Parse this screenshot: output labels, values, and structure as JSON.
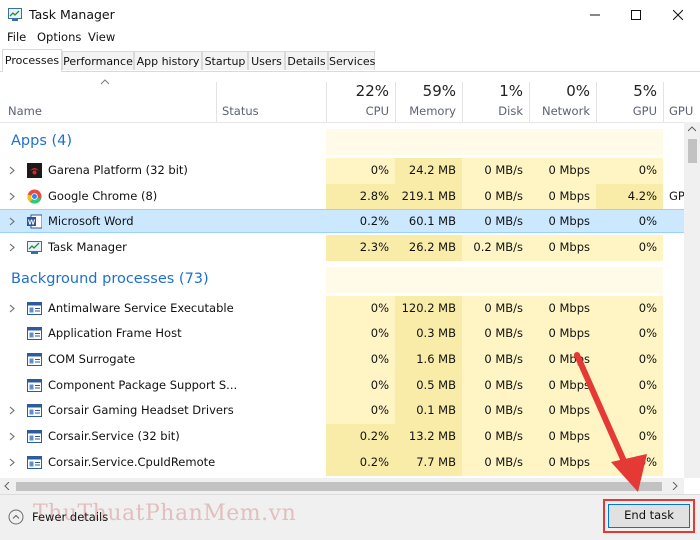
{
  "window": {
    "title": "Task Manager"
  },
  "menu": [
    "File",
    "Options",
    "View"
  ],
  "tabs": [
    "Processes",
    "Performance",
    "App history",
    "Startup",
    "Users",
    "Details",
    "Services"
  ],
  "active_tab": "Processes",
  "header": {
    "name": "Name",
    "status": "Status",
    "cpu": {
      "pct": "22%",
      "label": "CPU"
    },
    "memory": {
      "pct": "59%",
      "label": "Memory"
    },
    "disk": {
      "pct": "1%",
      "label": "Disk"
    },
    "network": {
      "pct": "0%",
      "label": "Network"
    },
    "gpu": {
      "pct": "5%",
      "label": "GPU"
    },
    "gpu_engine": {
      "label": "GPU e"
    }
  },
  "groups": {
    "apps": "Apps (4)",
    "background": "Background processes (73)"
  },
  "rows": [
    {
      "name": "Garena Platform (32 bit)",
      "icon": "garena-icon",
      "cpu": "0%",
      "memory": "24.2 MB",
      "disk": "0 MB/s",
      "network": "0 Mbps",
      "gpu": "0%",
      "gpu_engine": ""
    },
    {
      "name": "Google Chrome (8)",
      "icon": "chrome-icon",
      "cpu": "2.8%",
      "memory": "219.1 MB",
      "disk": "0 MB/s",
      "network": "0 Mbps",
      "gpu": "4.2%",
      "gpu_engine": "GP"
    },
    {
      "name": "Microsoft Word",
      "icon": "word-icon",
      "cpu": "0.2%",
      "memory": "60.1 MB",
      "disk": "0 MB/s",
      "network": "0 Mbps",
      "gpu": "0%",
      "gpu_engine": ""
    },
    {
      "name": "Task Manager",
      "icon": "task-manager-icon",
      "cpu": "2.3%",
      "memory": "26.2 MB",
      "disk": "0.2 MB/s",
      "network": "0 Mbps",
      "gpu": "0%",
      "gpu_engine": ""
    },
    {
      "name": "Antimalware Service Executable",
      "icon": "service-icon",
      "cpu": "0%",
      "memory": "120.2 MB",
      "disk": "0 MB/s",
      "network": "0 Mbps",
      "gpu": "0%",
      "gpu_engine": ""
    },
    {
      "name": "Application Frame Host",
      "icon": "service-icon",
      "cpu": "0%",
      "memory": "0.3 MB",
      "disk": "0 MB/s",
      "network": "0 Mbps",
      "gpu": "0%",
      "gpu_engine": ""
    },
    {
      "name": "COM Surrogate",
      "icon": "service-icon",
      "cpu": "0%",
      "memory": "1.6 MB",
      "disk": "0 MB/s",
      "network": "0 Mbps",
      "gpu": "0%",
      "gpu_engine": ""
    },
    {
      "name": "Component Package Support S...",
      "icon": "service-icon",
      "cpu": "0%",
      "memory": "0.5 MB",
      "disk": "0 MB/s",
      "network": "0 Mbps",
      "gpu": "0%",
      "gpu_engine": ""
    },
    {
      "name": "Corsair Gaming Headset Drivers",
      "icon": "service-icon",
      "cpu": "0%",
      "memory": "0.1 MB",
      "disk": "0 MB/s",
      "network": "0 Mbps",
      "gpu": "0%",
      "gpu_engine": ""
    },
    {
      "name": "Corsair.Service (32 bit)",
      "icon": "service-icon",
      "cpu": "0.2%",
      "memory": "13.2 MB",
      "disk": "0 MB/s",
      "network": "0 Mbps",
      "gpu": "0%",
      "gpu_engine": ""
    },
    {
      "name": "Corsair.Service.CpuIdRemote",
      "icon": "service-icon",
      "cpu": "0.2%",
      "memory": "7.7 MB",
      "disk": "0 MB/s",
      "network": "0 Mbps",
      "gpu": "0%",
      "gpu_engine": ""
    }
  ],
  "selected_row": "Microsoft Word",
  "footer": {
    "fewer_details": "Fewer details",
    "end_task": "End task",
    "watermark": "ThuThuatPhanMem.vn"
  },
  "colors": {
    "heat_light": "#fff4c4",
    "heat_medium": "#f9eca8",
    "heat_empty": "#fffbe8",
    "selected": "#cce8ff",
    "accent": "#1e6fd0",
    "callout": "#e53935"
  }
}
